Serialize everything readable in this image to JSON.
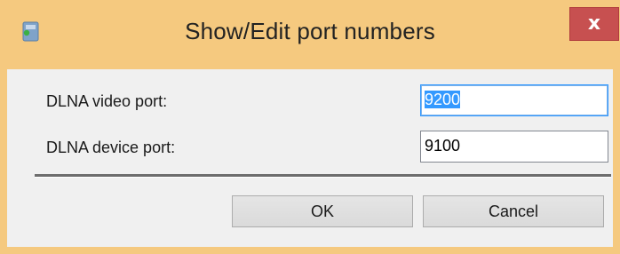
{
  "window": {
    "title": "Show/Edit port numbers",
    "close_label": "x",
    "titlebar_color": "#f5c97f",
    "close_color": "#c75050",
    "icon": "application-icon"
  },
  "form": {
    "video_port_label": "DLNA video port:",
    "video_port_value": "9200",
    "device_port_label": "DLNA device port:",
    "device_port_value": "9100"
  },
  "buttons": {
    "ok_label": "OK",
    "cancel_label": "Cancel"
  }
}
